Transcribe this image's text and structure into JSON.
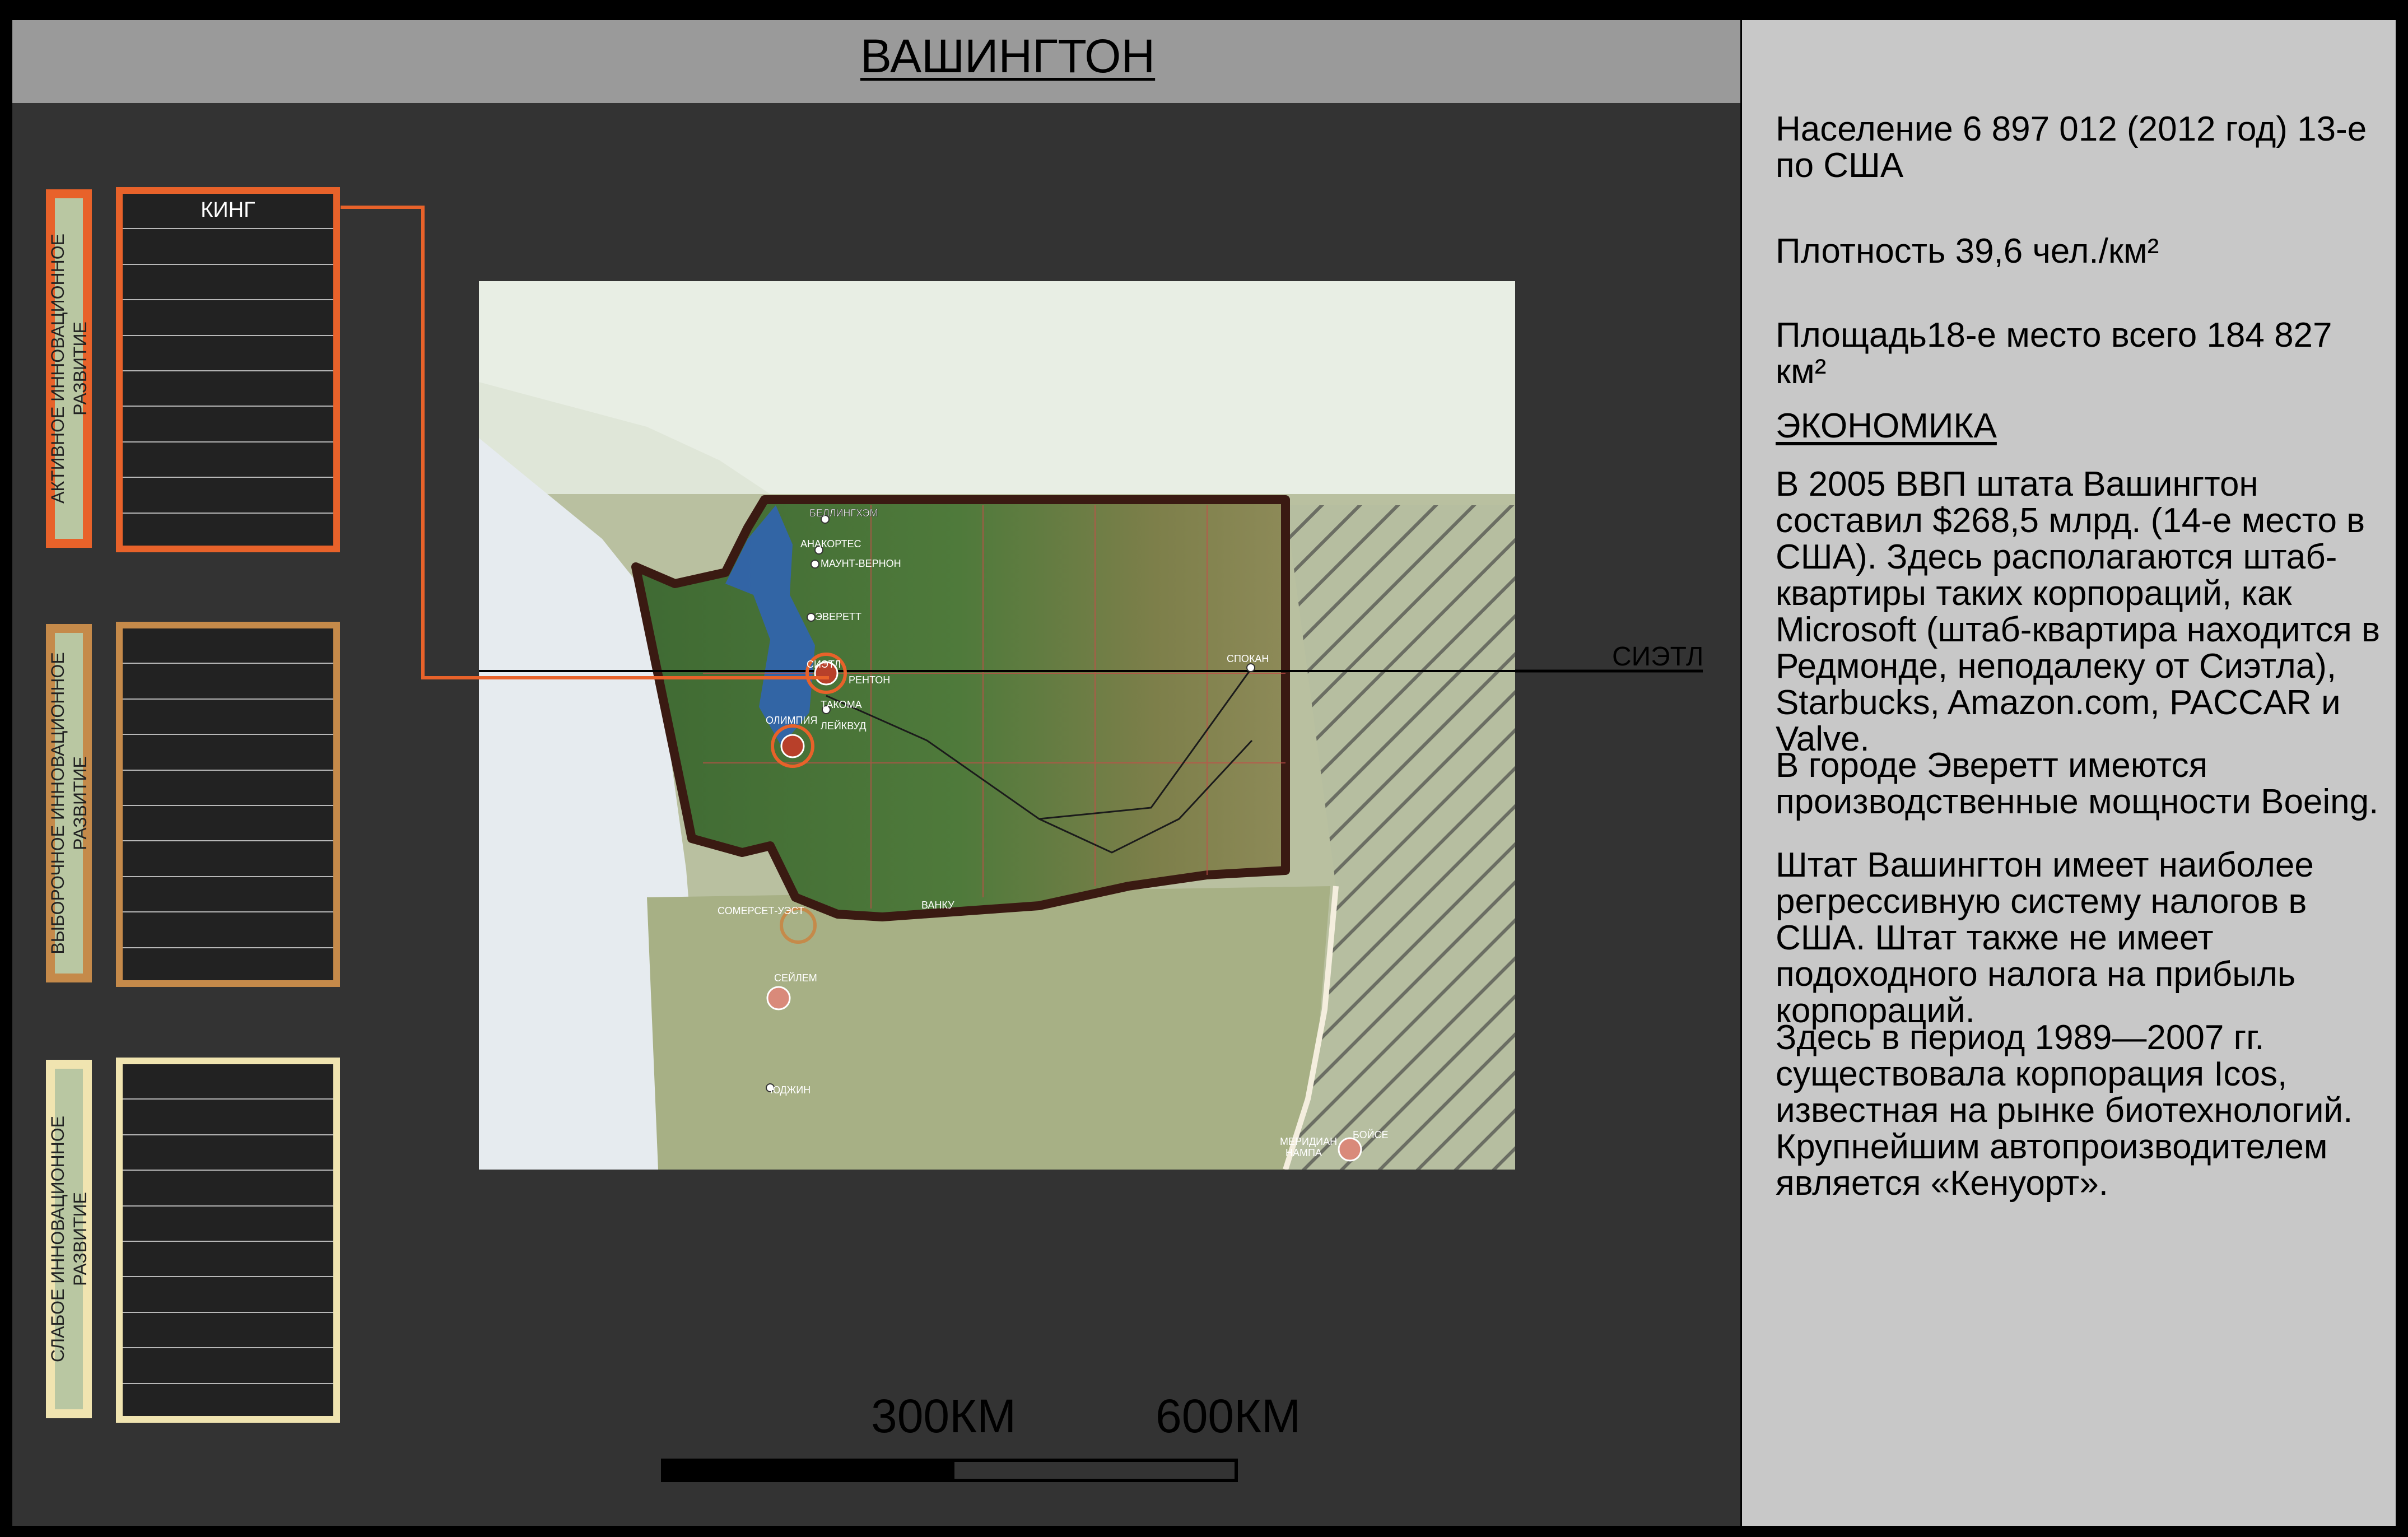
{
  "title": "ВАШИНГТОН",
  "info": {
    "population": "Население    6 897 012 (2012 год) 13-е по США",
    "density": "Плотность    39,6 чел./км²",
    "area": "Площадь18-е место всего  184 827 км²",
    "economy_heading": "ЭКОНОМИКА",
    "paragraphs": [
      "В 2005 ВВП штата Вашингтон составил $268,5 млрд. (14-е место в США). Здесь располагаются штаб-квартиры таких корпораций, как Microsoft (штаб-квартира находится в Редмонде, неподалеку от Сиэтла), Starbucks, Amazon.com, PACCAR и Valve.",
      "В городе Эверетт имеются производственные мощности Boeing.",
      "Штат Вашингтон имеет наиболее регрессивную систему налогов в США. Штат также не имеет подоходного налога на прибыль корпораций.",
      "Здесь в период 1989—2007 гг. существовала корпорация Icos, известная на рынке биотехнологий. Крупнейшим автопроизводителем является «Кенуорт»."
    ]
  },
  "legend": {
    "active": {
      "label_line1": "АКТИВНОЕ ИННОВАЦИОННОЕ",
      "label_line2": "РАЗВИТИЕ",
      "color": "#e8622a",
      "counties": [
        "КИНГ"
      ]
    },
    "selective": {
      "label_line1": "ВЫБОРОЧНОЕ ИННОВАЦИОННОЕ",
      "label_line2": "РАЗВИТИЕ",
      "color": "#c58a4a",
      "counties": []
    },
    "weak": {
      "label_line1": "СЛАБОЕ ИННОВАЦИОННОЕ",
      "label_line2": "РАЗВИТИЕ",
      "color": "#f0e4b0",
      "counties": []
    }
  },
  "map": {
    "callout_label": "СИЭТЛ",
    "cities": {
      "bellingham": "БЕЛЛИНГХЭМ",
      "anacortes": "АНАКОРТЕС",
      "mount_vernon": "МАУНТ-ВЕРНОН",
      "everett": "ЭВЕРЕТТ",
      "seattle": "СИЭТЛ",
      "renton": "РЕНТОН",
      "tacoma": "ТАКОМА",
      "olympia": "ОЛИМПИЯ",
      "lakewood": "ЛЕЙКВУД",
      "spokane": "СПОКАН",
      "somerset": "СОМЕРСЕТ-УЭСТ",
      "salem": "СЕЙЛЕМ",
      "eugene": "ЮДЖИН",
      "boise": "БОЙСЕ",
      "meridian": "МЕРИДИАН",
      "nampa": "НАМПА",
      "vancouver": "ВАНКУ"
    }
  },
  "scale": {
    "label_300": "300КМ",
    "label_600": "600КМ"
  },
  "colors": {
    "background": "#333333",
    "title_bar": "#9a9a9a",
    "info_panel": "#c8c8c8",
    "callout": "#e8622a",
    "state_border": "#3a1a12"
  }
}
